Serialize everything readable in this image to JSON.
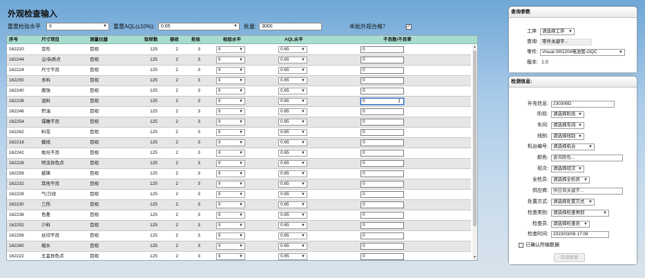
{
  "page_title": "外观检查输入",
  "toolbar": {
    "reset_level_label": "重置检验水平",
    "reset_level_value": "II",
    "reset_aql_label": "重置AQL(≤10%):",
    "reset_aql_value": "0.65",
    "batch_label": "批量:",
    "batch_value": "3000",
    "reject_label": "本批外观合格？",
    "reject_checked": "✓"
  },
  "table": {
    "headers": {
      "seq": "序号",
      "item": "尺寸项目",
      "instrument": "测量仪器",
      "sample": "取样数",
      "accept": "接收",
      "reject": "拒收",
      "level": "检验水平",
      "aql": "AQL水平",
      "defect": "不良数/不良率"
    },
    "rows": [
      {
        "seq": "162220",
        "item": "变形",
        "instrument": "目视",
        "sample": "125",
        "accept": "2",
        "reject": "3",
        "level": "II",
        "aql": "0.65",
        "defect": "0"
      },
      {
        "seq": "162244",
        "item": "尘/杂质点",
        "instrument": "目视",
        "sample": "125",
        "accept": "2",
        "reject": "3",
        "level": "II",
        "aql": "0.65",
        "defect": "0"
      },
      {
        "seq": "162224",
        "item": "尺寸不良",
        "instrument": "目视",
        "sample": "125",
        "accept": "2",
        "reject": "3",
        "level": "II",
        "aql": "0.65",
        "defect": "0"
      },
      {
        "seq": "162250",
        "item": "多料",
        "instrument": "目视",
        "sample": "125",
        "accept": "2",
        "reject": "3",
        "level": "II",
        "aql": "0.65",
        "defect": "0"
      },
      {
        "seq": "162240",
        "item": "腐蚀",
        "instrument": "目视",
        "sample": "125",
        "accept": "2",
        "reject": "3",
        "level": "II",
        "aql": "0.65",
        "defect": "0"
      },
      {
        "seq": "162238",
        "item": "混料",
        "instrument": "目视",
        "sample": "125",
        "accept": "2",
        "reject": "3",
        "level": "II",
        "aql": "0.65",
        "defect": "0"
      },
      {
        "seq": "162246",
        "item": "积油",
        "instrument": "目视",
        "sample": "125",
        "accept": "2",
        "reject": "3",
        "level": "II",
        "aql": "0.65",
        "defect": "0"
      },
      {
        "seq": "162254",
        "item": "镭雕不良",
        "instrument": "目视",
        "sample": "125",
        "accept": "2",
        "reject": "3",
        "level": "II",
        "aql": "0.65",
        "defect": "0"
      },
      {
        "seq": "162262",
        "item": "料花",
        "instrument": "目视",
        "sample": "125",
        "accept": "2",
        "reject": "3",
        "level": "II",
        "aql": "0.65",
        "defect": "0"
      },
      {
        "seq": "162218",
        "item": "模线",
        "instrument": "目视",
        "sample": "125",
        "accept": "2",
        "reject": "3",
        "level": "II",
        "aql": "0.65",
        "defect": "0"
      },
      {
        "seq": "162242",
        "item": "抛光不良",
        "instrument": "目视",
        "sample": "125",
        "accept": "2",
        "reject": "3",
        "level": "II",
        "aql": "0.65",
        "defect": "0"
      },
      {
        "seq": "162226",
        "item": "喷涂异色点",
        "instrument": "目视",
        "sample": "125",
        "accept": "2",
        "reject": "3",
        "level": "II",
        "aql": "0.65",
        "defect": "0"
      },
      {
        "seq": "162258",
        "item": "披锋",
        "instrument": "目视",
        "sample": "125",
        "accept": "2",
        "reject": "3",
        "level": "II",
        "aql": "0.65",
        "defect": "0"
      },
      {
        "seq": "162232",
        "item": "其他不良",
        "instrument": "目视",
        "sample": "125",
        "accept": "2",
        "reject": "3",
        "level": "II",
        "aql": "0.65",
        "defect": "0"
      },
      {
        "seq": "162228",
        "item": "气/刀纹",
        "instrument": "目视",
        "sample": "125",
        "accept": "2",
        "reject": "3",
        "level": "II",
        "aql": "0.65",
        "defect": "0"
      },
      {
        "seq": "162230",
        "item": "三伤",
        "instrument": "目视",
        "sample": "125",
        "accept": "2",
        "reject": "3",
        "level": "II",
        "aql": "0.65",
        "defect": "0"
      },
      {
        "seq": "162236",
        "item": "色差",
        "instrument": "目视",
        "sample": "125",
        "accept": "2",
        "reject": "3",
        "level": "II",
        "aql": "0.65",
        "defect": "0"
      },
      {
        "seq": "162252",
        "item": "少料",
        "instrument": "目视",
        "sample": "125",
        "accept": "2",
        "reject": "3",
        "level": "II",
        "aql": "0.65",
        "defect": "0"
      },
      {
        "seq": "162256",
        "item": "丝印不良",
        "instrument": "目视",
        "sample": "125",
        "accept": "2",
        "reject": "3",
        "level": "II",
        "aql": "0.65",
        "defect": "0"
      },
      {
        "seq": "162260",
        "item": "缩水",
        "instrument": "目视",
        "sample": "125",
        "accept": "2",
        "reject": "3",
        "level": "II",
        "aql": "0.65",
        "defect": "0"
      },
      {
        "seq": "162222",
        "item": "五金异色点",
        "instrument": "目视",
        "sample": "125",
        "accept": "2",
        "reject": "3",
        "level": "II",
        "aql": "0.65",
        "defect": "0"
      }
    ]
  },
  "query_panel": {
    "title": "查询参数",
    "process_label": "工序:",
    "process_value": "请选择工序",
    "query_label": "查询:",
    "query_placeholder": "零件关键字...",
    "part_label": "零件:",
    "part_value": "Visual-SR2204电池管-OQC",
    "version_label": "版本:",
    "version_value": "1.0"
  },
  "inspect_panel": {
    "title": "检测信息:",
    "supplement_label": "补充信息:",
    "supplement_value": "230308D",
    "stage_label": "阶段:",
    "stage_value": "请选择阶段",
    "workshop_label": "车间:",
    "workshop_value": "请选择车间",
    "line_label": "线别:",
    "line_value": "请选择线别",
    "machine_label": "机台编号:",
    "machine_value": "请选择机台",
    "color_label": "颜色:",
    "color_placeholder": "查询颜色...",
    "shift_label": "班次:",
    "shift_value": "请选择班次",
    "inspector_label": "全检员:",
    "inspector_value": "请选择全检员",
    "supplier_label": "供应商:",
    "supplier_placeholder": "供应商关键字...",
    "disposal_label": "处置方式:",
    "disposal_value": "请选择处置方式",
    "check_type_label": "检查类别:",
    "check_type_value": "请选择检查类别",
    "checker_label": "检查员:",
    "checker_value": "请选择检查员",
    "check_time_label": "检查时间:",
    "check_time_value": "2023/03/08 17:08",
    "confirm_label": "已确认所输数据",
    "save_label": "存储数据"
  }
}
